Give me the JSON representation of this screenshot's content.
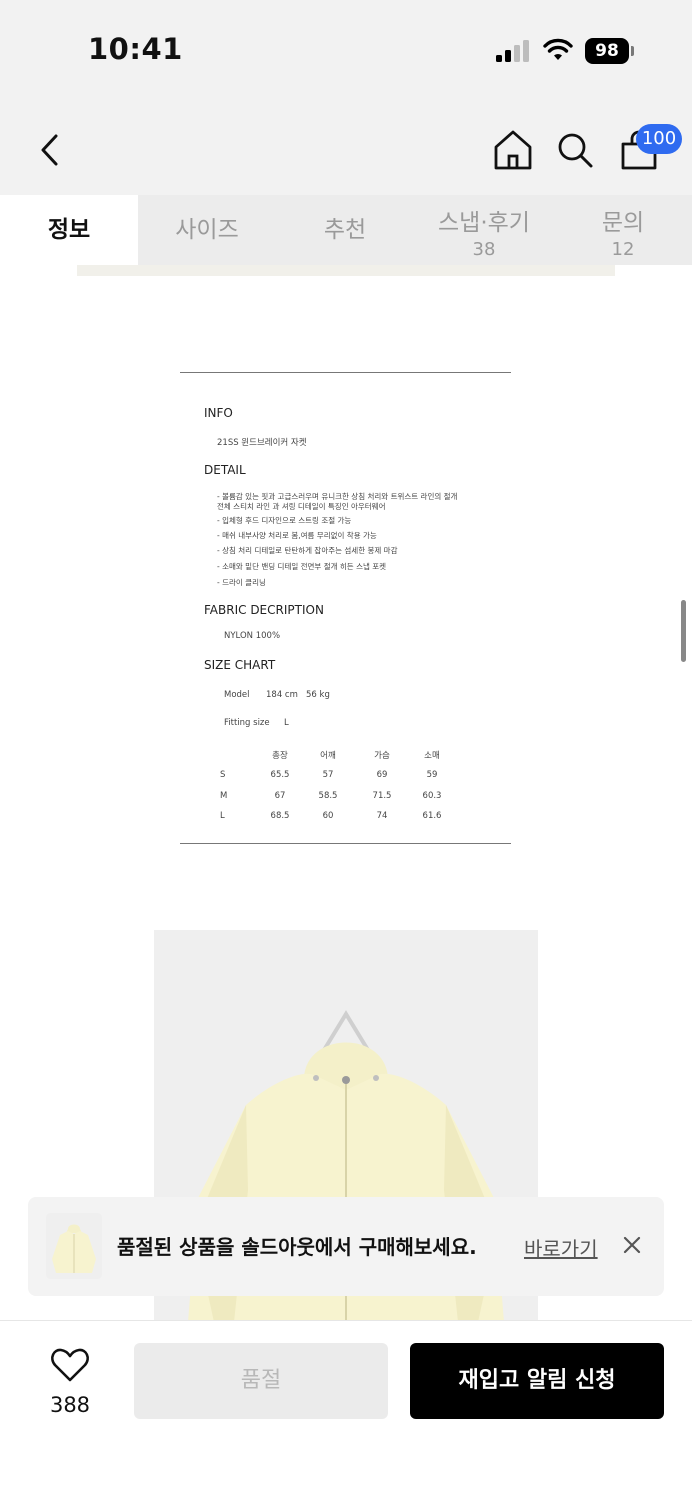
{
  "status_bar": {
    "time": "10:41",
    "battery": "98"
  },
  "nav": {
    "cart_count": "100"
  },
  "tabs": [
    {
      "label": "정보",
      "count": ""
    },
    {
      "label": "사이즈",
      "count": ""
    },
    {
      "label": "추천",
      "count": ""
    },
    {
      "label": "스냅·후기",
      "count": "38"
    },
    {
      "label": "문의",
      "count": "12"
    }
  ],
  "info_sheet": {
    "info_title": "INFO",
    "info_text": "21SS 윈드브레이커 자켓",
    "detail_title": "DETAIL",
    "detail_lines": [
      "- 볼륨감 있는 핏과 고급스러우며 유니크한 상침 처리와 트위스트 라인의 절개",
      "  전체 스티치 라인 과 셔링 디테일이 특징인 아우터웨어",
      "- 입체형 후드 디자인으로 스트링 조절 가능",
      "- 매쉬 내부사양 처리로 봄,여름 무리없이 착용 가능",
      "- 상침 처리 디테일로 탄탄하게 잡아주는 섬세한 봉제 마감",
      "- 소매와 밑단 밴딩 디테일 전면부 절개 히든 스냅 포켓",
      "- 드라이 클리닝"
    ],
    "fabric_title": "FABRIC DECRIPTION",
    "fabric_text": "NYLON 100%",
    "size_title": "SIZE CHART",
    "model_label": "Model",
    "model_height": "184 cm",
    "model_weight": "56 kg",
    "fitting_label": "Fitting size",
    "fitting_value": "L",
    "size_headers": [
      "총장",
      "어깨",
      "가슴",
      "소매"
    ],
    "size_rows": [
      {
        "size": "S",
        "values": [
          "65.5",
          "57",
          "69",
          "59"
        ]
      },
      {
        "size": "M",
        "values": [
          "67",
          "58.5",
          "71.5",
          "60.3"
        ]
      },
      {
        "size": "L",
        "values": [
          "68.5",
          "60",
          "74",
          "61.6"
        ]
      }
    ]
  },
  "toast": {
    "message": "품절된 상품을 솔드아웃에서 구매해보세요.",
    "link": "바로가기"
  },
  "bottom_bar": {
    "like_count": "388",
    "soldout_label": "품절",
    "restock_label": "재입고 알림 신청"
  },
  "colors": {
    "badge": "#2f6bf0",
    "primary_button": "#000000",
    "jacket": "#f7f3cf"
  }
}
